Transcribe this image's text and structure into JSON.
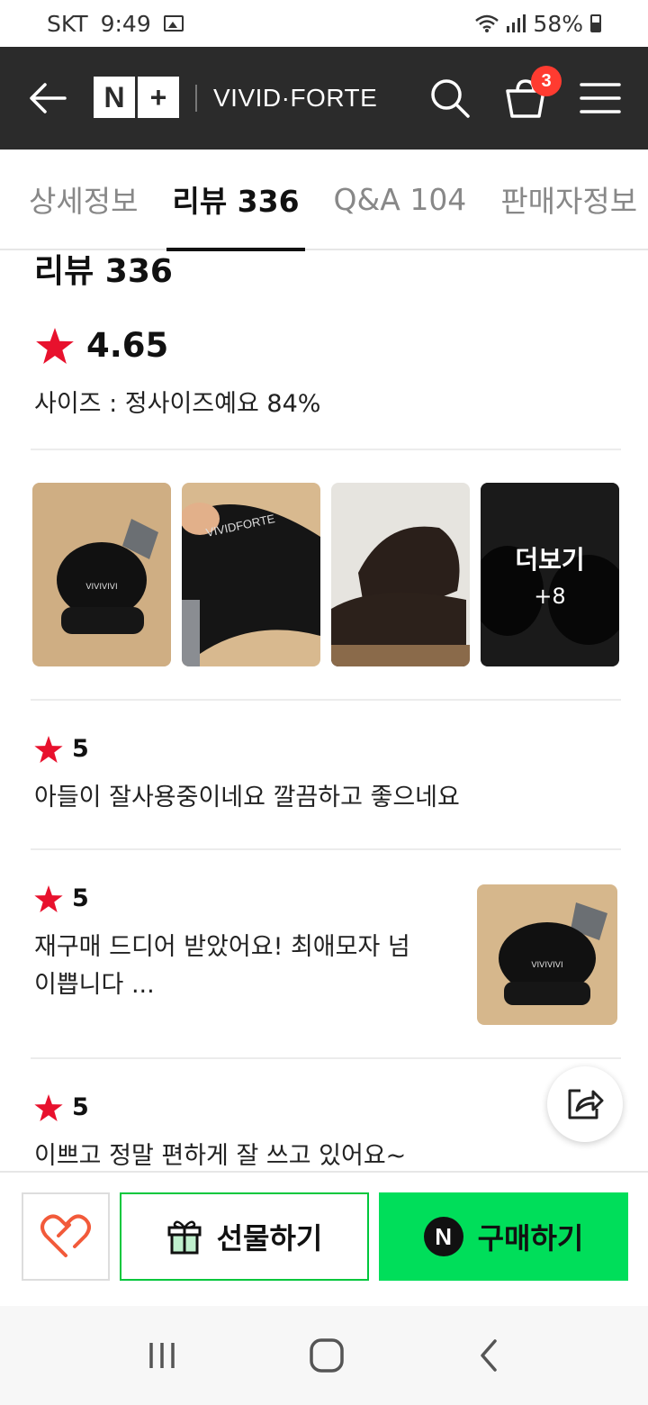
{
  "status_bar": {
    "carrier": "SKT",
    "time": "9:49",
    "battery": "58%"
  },
  "header": {
    "brand": "VIVID·FORTE",
    "logo_left": "N",
    "logo_right": "+",
    "cart_count": "3"
  },
  "tabs": [
    {
      "label": "상세정보"
    },
    {
      "label": "리뷰 336"
    },
    {
      "label": "Q&A 104"
    },
    {
      "label": "판매자정보"
    }
  ],
  "reviews_section": {
    "title": "리뷰 336",
    "rating": "4.65",
    "size_info": "사이즈 : 정사이즈예요 84%",
    "more_label": "더보기",
    "more_count": "+8"
  },
  "reviews": [
    {
      "rating": "5",
      "text": "아들이 잘사용중이네요 깔끔하고 좋으네요"
    },
    {
      "rating": "5",
      "text_line1": "재구매 드디어 받았어요! 최애모자 넘",
      "text_line2": "이쁩니다 ..."
    },
    {
      "rating": "5",
      "text": "이쁘고 정말 편하게 잘 쓰고 있어요~"
    }
  ],
  "bottom_bar": {
    "gift_label": "선물하기",
    "buy_label": "구매하기",
    "buy_icon_letter": "N"
  },
  "colors": {
    "accent_green": "#00de5a",
    "gift_border": "#00c73c",
    "star_red": "#e8112d",
    "header_bg": "#2b2b2b"
  }
}
